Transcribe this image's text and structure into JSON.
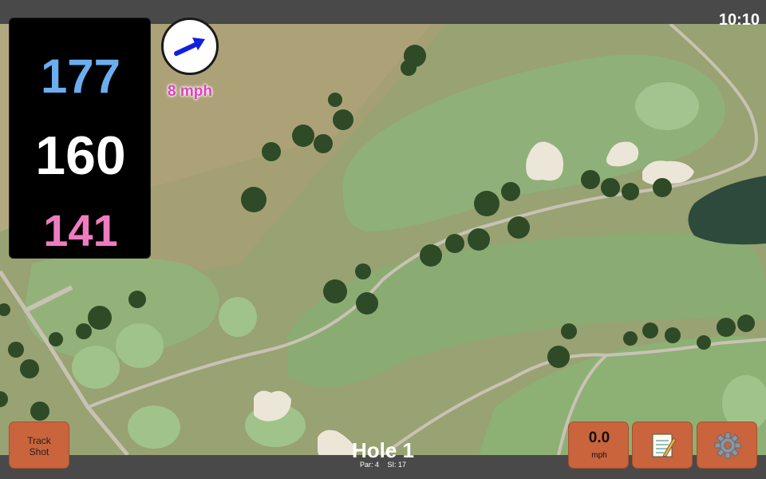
{
  "status": {
    "time": "10:10"
  },
  "distances": {
    "back": "177",
    "middle": "160",
    "front": "141",
    "back_color": "#6aaef0",
    "middle_color": "#ffffff",
    "front_color": "#f07cc0"
  },
  "wind": {
    "speed": "8 mph",
    "arrow_color": "#1020e0",
    "icon": "wind-direction-arrow-icon"
  },
  "buttons": {
    "track_shot": "Track\nShot",
    "speed_value": "0.0",
    "speed_unit": "mph",
    "notes_icon": "notepad-icon",
    "settings_icon": "gear-icon"
  },
  "hole": {
    "title": "Hole 1",
    "par": "Par: 4",
    "si": "SI: 17"
  },
  "colors": {
    "button": "#c9643c",
    "rough": "#a9a274",
    "fairway": "#86a56a",
    "green": "#9bbf86",
    "bunker": "#ece6d8",
    "water": "#2d4a3c",
    "path": "#c8c2b4"
  }
}
